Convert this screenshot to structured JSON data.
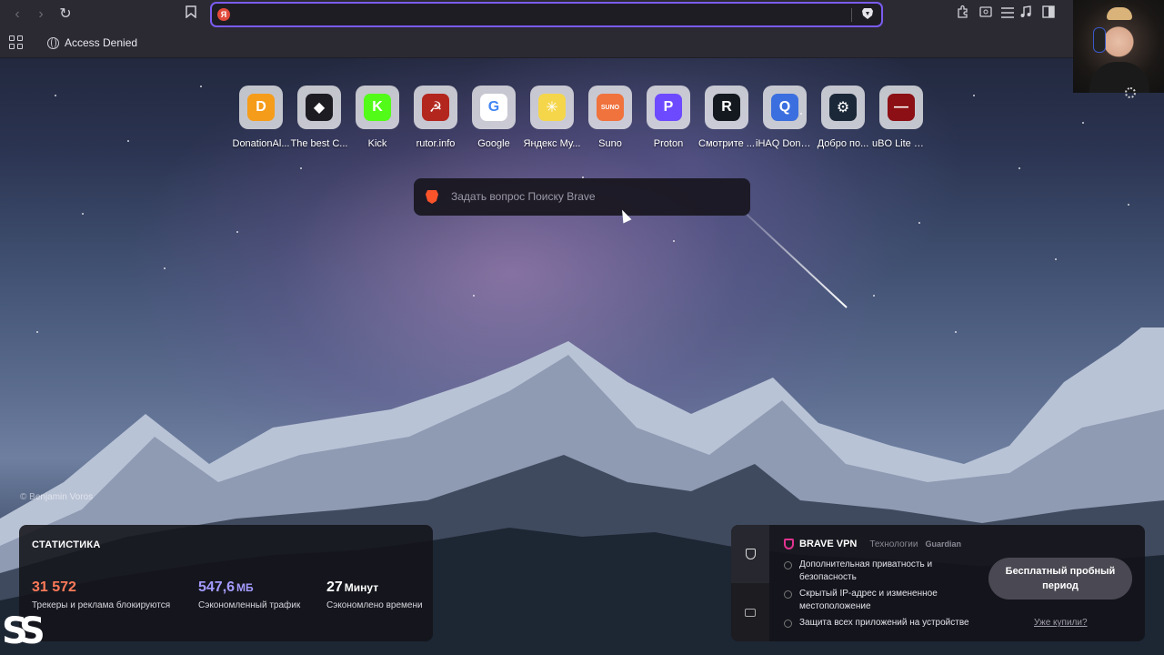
{
  "toolbar": {
    "back_icon": "chevron-left-icon",
    "forward_icon": "chevron-right-icon",
    "reload_icon": "reload-icon",
    "bookmark_icon": "bookmark-icon",
    "url_favicon_letter": "Я",
    "url_value": "",
    "right_icons": [
      "extensions-icon",
      "reader-icon",
      "menu-icon",
      "music-icon",
      "sidebar-icon",
      "window-icon"
    ]
  },
  "bookmarks_bar": {
    "items": [
      {
        "label": "Access Denied",
        "icon": "globe-icon"
      }
    ]
  },
  "shortcuts": [
    {
      "label": "DonationAl...",
      "icon": "donationalerts-icon",
      "color": "#f59c1a",
      "glyph": "D"
    },
    {
      "label": "The best C...",
      "icon": "game-controller-icon",
      "color": "#1c1c22",
      "glyph": "◆"
    },
    {
      "label": "Kick",
      "icon": "kick-icon",
      "color": "#53fc18",
      "glyph": "K"
    },
    {
      "label": "rutor.info",
      "icon": "rutor-icon",
      "color": "#b3261e",
      "glyph": "☭"
    },
    {
      "label": "Google",
      "icon": "google-icon",
      "color": "#ffffff",
      "glyph": "G"
    },
    {
      "label": "Яндекс Му...",
      "icon": "yandex-music-icon",
      "color": "#f5d64a",
      "glyph": "✳"
    },
    {
      "label": "Suno",
      "icon": "suno-icon",
      "color": "#f0723c",
      "glyph": "SUNO"
    },
    {
      "label": "Proton",
      "icon": "proton-icon",
      "color": "#6d4aff",
      "glyph": "P"
    },
    {
      "label": "Смотрите ...",
      "icon": "rutube-icon",
      "color": "#14191f",
      "glyph": "R"
    },
    {
      "label": "iHAQ Dona...",
      "icon": "ihaq-icon",
      "color": "#3b6fe0",
      "glyph": "Q"
    },
    {
      "label": "Добро по...",
      "icon": "steam-icon",
      "color": "#1b2838",
      "glyph": "⚙"
    },
    {
      "label": "uBO Lite —...",
      "icon": "ublock-icon",
      "color": "#8b0f14",
      "glyph": "—"
    }
  ],
  "search": {
    "placeholder": "Задать вопрос Поиску Brave"
  },
  "photo_credit": "© Benjamin Voros",
  "stats": {
    "title": "СТАТИСТИКА",
    "items": [
      {
        "value": "31 572",
        "unit": "",
        "label": "Трекеры и реклама блокируются",
        "color": "#ff7a59"
      },
      {
        "value": "547,6",
        "unit": "МБ",
        "label": "Сэкономленный трафик",
        "color": "#a59bff"
      },
      {
        "value": "27",
        "unit": "Минут",
        "label": "Сэкономлено времени",
        "color": "#ffffff"
      }
    ]
  },
  "vpn": {
    "title": "BRAVE VPN",
    "tech_label": "Технологии",
    "tech_brand": "Guardian",
    "features": [
      "Дополнительная приватность и безопасность",
      "Скрытый IP-адрес и измененное местоположение",
      "Защита всех приложений на устройстве"
    ],
    "cta": "Бесплатный пробный период",
    "link": "Уже купили?"
  },
  "corner_logo": "SS"
}
